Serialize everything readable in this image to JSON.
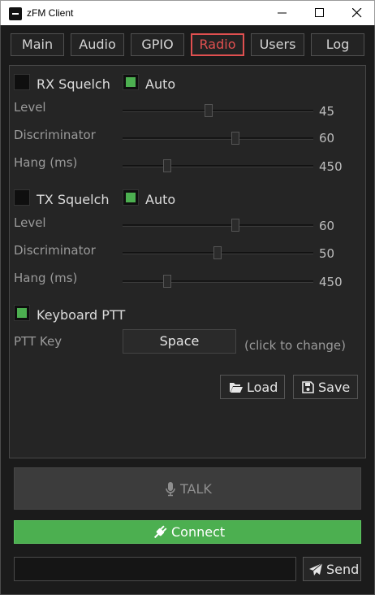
{
  "window": {
    "title": "zFM Client"
  },
  "tabs": [
    {
      "label": "Main"
    },
    {
      "label": "Audio"
    },
    {
      "label": "GPIO"
    },
    {
      "label": "Radio",
      "active": true
    },
    {
      "label": "Users"
    },
    {
      "label": "Log"
    }
  ],
  "rx": {
    "squelch_label": "RX Squelch",
    "squelch_checked": false,
    "auto_label": "Auto",
    "auto_checked": true,
    "level_label": "Level",
    "level_value": "45",
    "discriminator_label": "Discriminator",
    "discriminator_value": "60",
    "hang_label": "Hang (ms)",
    "hang_value": "450"
  },
  "tx": {
    "squelch_label": "TX Squelch",
    "squelch_checked": false,
    "auto_label": "Auto",
    "auto_checked": true,
    "level_label": "Level",
    "level_value": "60",
    "discriminator_label": "Discriminator",
    "discriminator_value": "50",
    "hang_label": "Hang (ms)",
    "hang_value": "450"
  },
  "ptt": {
    "keyboard_label": "Keyboard PTT",
    "keyboard_checked": true,
    "key_label": "PTT Key",
    "key_value": "Space",
    "hint": "(click to change)"
  },
  "actions": {
    "load_label": "Load",
    "save_label": "Save",
    "talk_label": "TALK",
    "connect_label": "Connect",
    "send_label": "Send"
  },
  "message": {
    "value": "",
    "placeholder": ""
  },
  "colors": {
    "accent_active_tab": "#e05050",
    "checkbox_on": "#4caf50",
    "connect_button": "#4caf50",
    "background": "#1b1b1b"
  },
  "icons": {
    "talk": "microphone-icon",
    "connect": "plug-icon",
    "load": "folder-open-icon",
    "save": "floppy-disk-icon",
    "send": "paper-plane-icon"
  }
}
